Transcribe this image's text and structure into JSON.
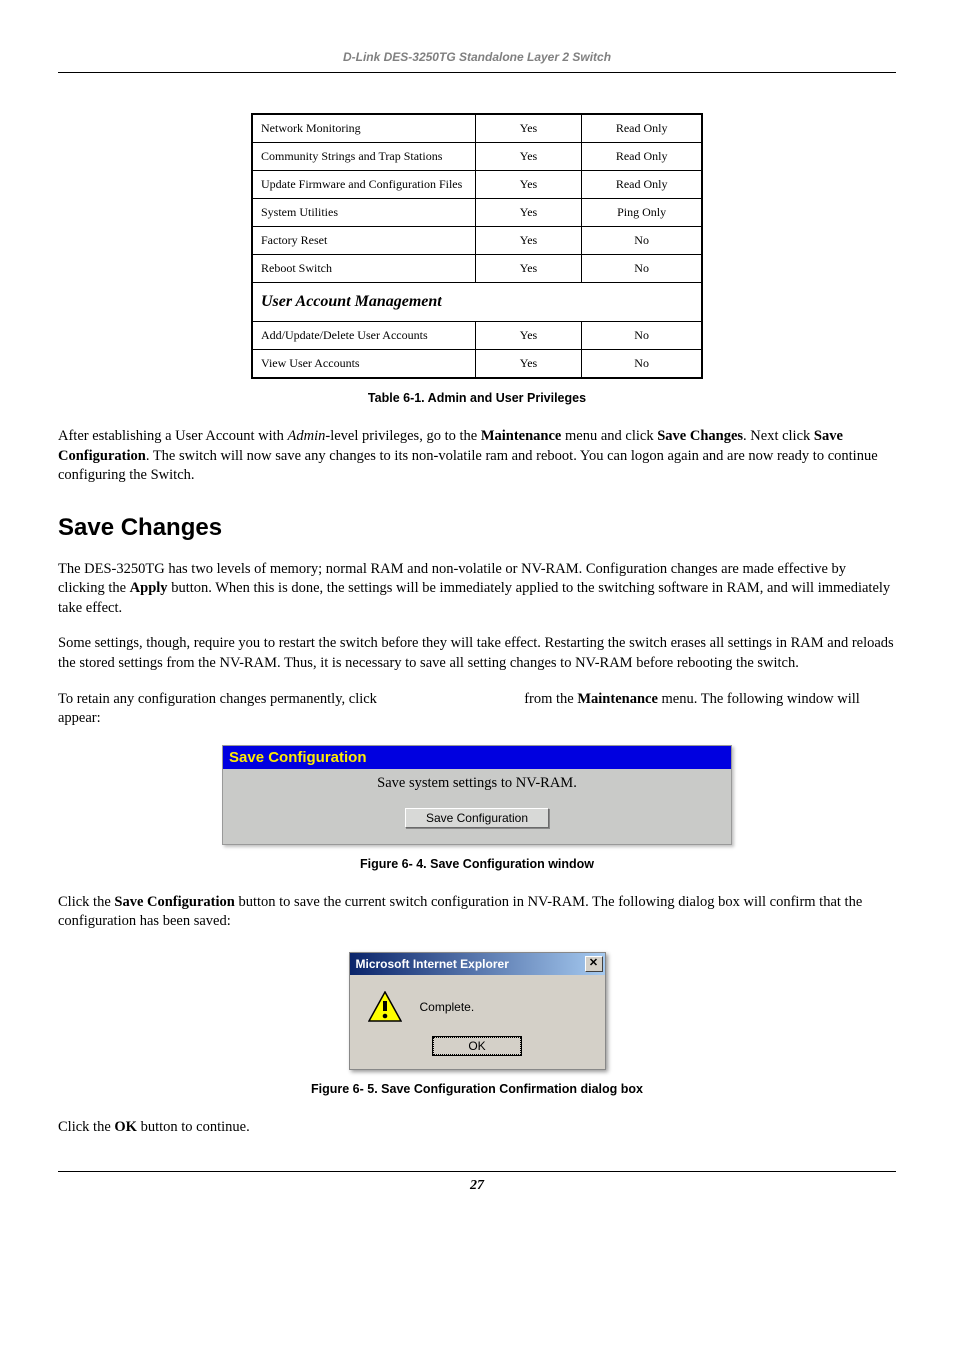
{
  "header": "D-Link DES-3250TG Standalone Layer 2 Switch",
  "table": {
    "rows_a": [
      {
        "c1": "Network Monitoring",
        "c2": "Yes",
        "c3": "Read Only"
      },
      {
        "c1": "Community Strings and Trap Stations",
        "c2": "Yes",
        "c3": "Read Only"
      },
      {
        "c1": "Update Firmware and Configuration Files",
        "c2": "Yes",
        "c3": "Read Only"
      },
      {
        "c1": "System Utilities",
        "c2": "Yes",
        "c3": "Ping Only"
      },
      {
        "c1": "Factory Reset",
        "c2": "Yes",
        "c3": "No"
      },
      {
        "c1": "Reboot Switch",
        "c2": "Yes",
        "c3": "No"
      }
    ],
    "section_header": "User Account Management",
    "rows_b": [
      {
        "c1": "Add/Update/Delete User Accounts",
        "c2": "Yes",
        "c3": "No"
      },
      {
        "c1": "View User Accounts",
        "c2": "Yes",
        "c3": "No"
      }
    ],
    "caption": "Table 6-1.  Admin and User Privileges"
  },
  "para1_a": "After establishing a User Account with ",
  "para1_admin": "Admin",
  "para1_b": "-level privileges, go to the ",
  "para1_maint": "Maintenance",
  "para1_c": " menu and click ",
  "para1_savechanges": "Save Changes",
  "para1_d": ". Next click ",
  "para1_savecfg": "Save Configuration",
  "para1_e": ". The switch will now save any changes to its non-volatile ram and reboot. You can logon again and are now ready to continue configuring the Switch.",
  "heading": "Save Changes",
  "para2_a": "The DES-3250TG has two levels of memory; normal RAM and non-volatile or NV-RAM. Configuration changes are made effective by clicking the ",
  "para2_apply": "Apply",
  "para2_b": " button. When this is done, the settings will be immediately applied to the switching software in RAM, and will immediately take effect.",
  "para3": "Some settings, though, require you to restart the switch before they will take effect. Restarting the switch erases all settings in RAM and reloads the stored settings from the NV-RAM. Thus, it is necessary to save all setting changes to NV-RAM before rebooting the switch.",
  "para4_a": "To retain any configuration changes permanently, click ",
  "para4_b": "from the ",
  "para4_maint": "Maintenance",
  "para4_c": " menu. The following window will appear:",
  "savecfg": {
    "title": "Save Configuration",
    "message": "Save system settings to NV-RAM.",
    "button": "Save Configuration"
  },
  "fig1_caption": "Figure 6- 4.  Save Configuration window",
  "para5_a": "Click the ",
  "para5_savecfg": "Save Configuration",
  "para5_b": " button to save the current switch configuration in NV-RAM. The following dialog box will confirm that the configuration has been saved:",
  "dialog": {
    "title": "Microsoft Internet Explorer",
    "message": "Complete.",
    "ok": "OK"
  },
  "fig2_caption": "Figure 6- 5.  Save Configuration Confirmation dialog box",
  "para6_a": "Click the ",
  "para6_ok": "OK",
  "para6_b": " button to continue.",
  "page_number": "27"
}
